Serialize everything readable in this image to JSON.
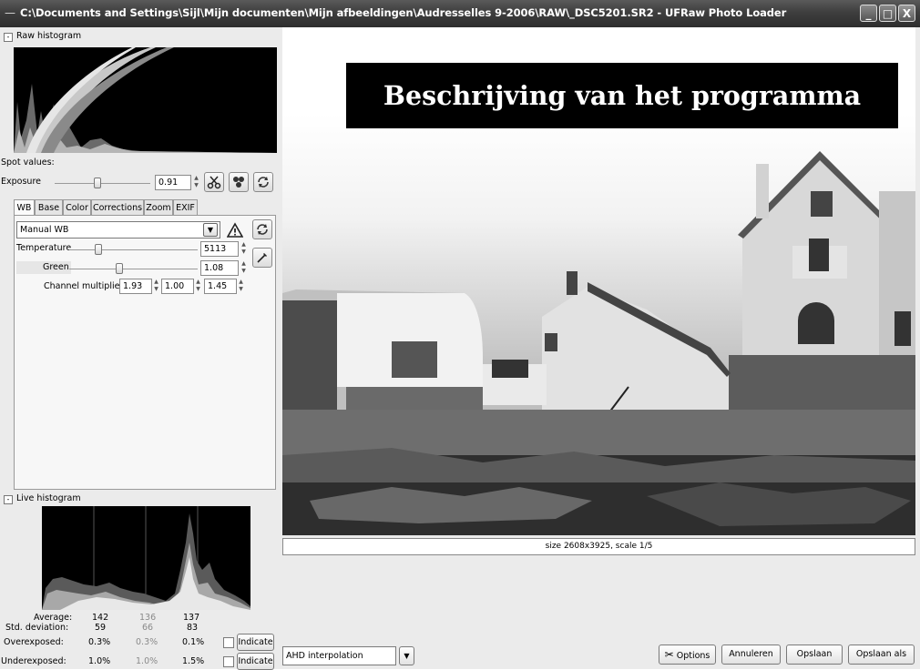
{
  "window": {
    "title": "C:\\Documents and Settings\\Sijl\\Mijn documenten\\Mijn afbeeldingen\\Audresselles 9-2006\\RAW\\_DSC5201.SR2 - UFRaw Photo Loader",
    "minimize": "_",
    "maximize": "□",
    "close": "X"
  },
  "raw_histogram": {
    "label": "Raw histogram"
  },
  "spot_values": {
    "label": "Spot values:"
  },
  "exposure": {
    "label": "Exposure",
    "value": "0.91",
    "level": 0.45
  },
  "tabs": [
    {
      "label": "WB"
    },
    {
      "label": "Base"
    },
    {
      "label": "Color"
    },
    {
      "label": "Corrections"
    },
    {
      "label": "Zoom"
    },
    {
      "label": "EXIF"
    }
  ],
  "wb": {
    "preset": "Manual WB",
    "temperature": {
      "label": "Temperature",
      "value": "5113",
      "level": 0.23
    },
    "green": {
      "label": "Green",
      "value": "1.08",
      "level": 0.39
    },
    "channel_multipliers": {
      "label": "Channel multipliers:",
      "r": "1.93",
      "g": "1.00",
      "b": "1.45"
    }
  },
  "live_histogram": {
    "label": "Live histogram",
    "average": {
      "label": "Average:",
      "r": "142",
      "g": "136",
      "b": "137"
    },
    "std_deviation": {
      "label": "Std. deviation:",
      "r": "59",
      "g": "66",
      "b": "83"
    },
    "overexposed": {
      "label": "Overexposed:",
      "r": "0.3%",
      "g": "0.3%",
      "b": "0.1%",
      "button": "Indicate"
    },
    "underexposed": {
      "label": "Underexposed:",
      "r": "1.0%",
      "g": "1.0%",
      "b": "1.5%",
      "button": "Indicate"
    }
  },
  "caption": "Beschrijving van het programma",
  "image_info": "size 2608x3925, scale 1/5",
  "bottom": {
    "interpolation": "AHD interpolation",
    "options_button": "Options",
    "cancel_button": "Annuleren",
    "save_button": "Opslaan",
    "save_as_button": "Opslaan als"
  },
  "colors": {
    "titlebar": "#3e3e3e",
    "panel": "#ebebeb",
    "histogram_bg": "#000000"
  },
  "icons": {
    "system_menu": "minus-icon",
    "cut": "scissors-icon",
    "auto_adjust": "clover-icon",
    "reset": "reset-arrows-icon",
    "warning": "warning-triangle-icon",
    "spot_wb": "eyedropper-icon"
  }
}
